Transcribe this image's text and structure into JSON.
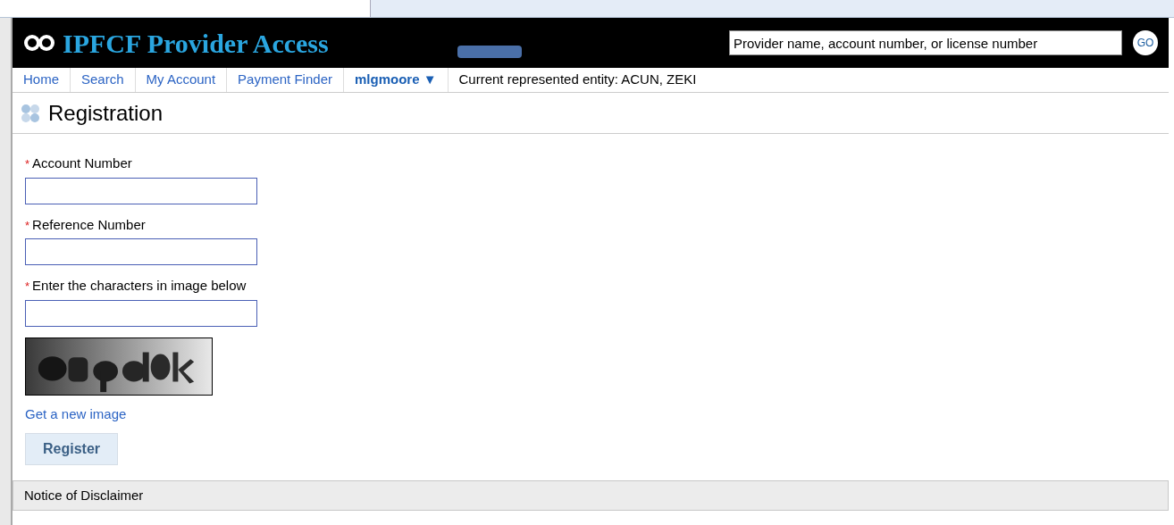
{
  "header": {
    "title": "IPFCF Provider Access",
    "search": {
      "placeholder": "Provider name, account number, or license number"
    },
    "go_button": "GO"
  },
  "nav": {
    "items": [
      {
        "label": "Home",
        "kind": "link"
      },
      {
        "label": "Search",
        "kind": "link"
      },
      {
        "label": "My Account",
        "kind": "link"
      },
      {
        "label": "Payment Finder",
        "kind": "link"
      },
      {
        "label": "mlgmoore ▼",
        "kind": "menu"
      }
    ],
    "entity": "Current represented entity: ACUN, ZEKI"
  },
  "page_title": "Registration",
  "form": {
    "fields": [
      {
        "label": "Account Number",
        "required": true
      },
      {
        "label": "Reference Number",
        "required": true
      },
      {
        "label": "Enter the characters in image below",
        "required": true
      }
    ],
    "required_mark": "*",
    "new_image_link": "Get a new image",
    "submit": "Register"
  },
  "disclaimer": "Notice of Disclaimer"
}
